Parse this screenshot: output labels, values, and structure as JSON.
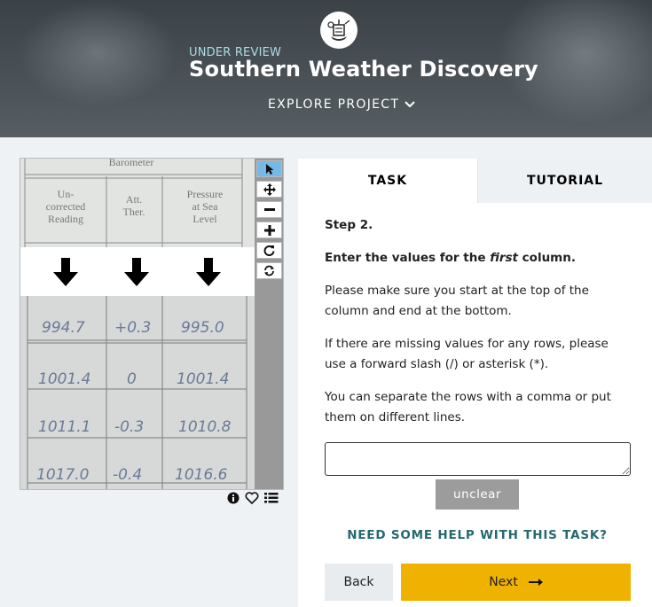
{
  "header": {
    "status": "UNDER REVIEW",
    "project_title": "Southern Weather Discovery",
    "explore_label": "EXPLORE PROJECT"
  },
  "subject": {
    "heading": "Barometer",
    "columns": [
      "Un-\ncorrected\nReading",
      "Att.\nTher.",
      "Pressure\nat Sea\nLevel"
    ],
    "rows": [
      [
        "994.7",
        "+0.3",
        "995.0"
      ],
      [
        "1001.4",
        "0",
        "1001.4"
      ],
      [
        "1011.1",
        "-0.3",
        "1010.8"
      ],
      [
        "1017.0",
        "-0.4",
        "1016.6"
      ]
    ]
  },
  "toolbar": {
    "tools": [
      "pointer-icon",
      "move-icon",
      "zoom-out-icon",
      "zoom-in-icon",
      "rotate-icon",
      "reset-icon"
    ]
  },
  "tabs": {
    "task": "TASK",
    "tutorial": "TUTORIAL"
  },
  "task": {
    "step": "Step 2.",
    "instruction_pre": "Enter the values for the ",
    "instruction_em": "first",
    "instruction_post": " column.",
    "p1": "Please make sure you start at the top of the column and end at the bottom.",
    "p2": "If there are missing values for any rows, please use a forward slash (/) or asterisk (*).",
    "p3": "You can separate the rows with a comma or put them on different lines.",
    "answer_value": "",
    "unclear_label": "unclear",
    "help_label": "NEED SOME HELP WITH THIS TASK?",
    "back_label": "Back",
    "next_label": "Next"
  },
  "colors": {
    "next": "#f0b200",
    "help": "#246a6f",
    "status": "#a9dde3"
  }
}
